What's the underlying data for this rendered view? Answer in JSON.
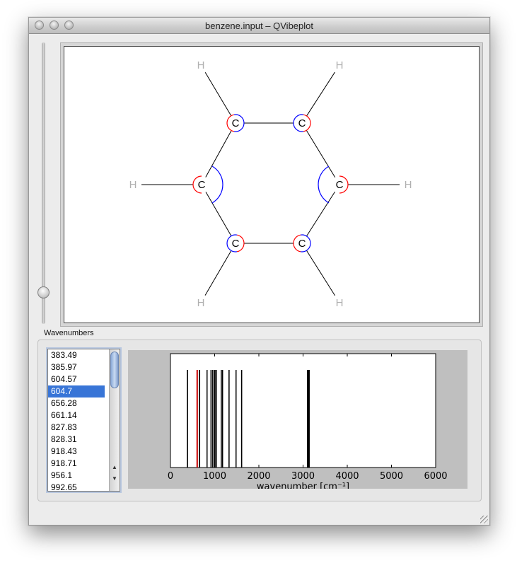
{
  "window": {
    "title": "benzene.input – QVibeplot"
  },
  "molecule": {
    "atoms": [
      {
        "label": "C"
      },
      {
        "label": "C"
      },
      {
        "label": "C"
      },
      {
        "label": "C"
      },
      {
        "label": "C"
      },
      {
        "label": "C"
      },
      {
        "label": "H"
      },
      {
        "label": "H"
      },
      {
        "label": "H"
      },
      {
        "label": "H"
      },
      {
        "label": "H"
      },
      {
        "label": "H"
      }
    ],
    "colors": {
      "carbon_text": "#000000",
      "hydrogen_text": "#b0b0b0",
      "mode_positive": "#0000ff",
      "mode_negative": "#ff0000",
      "bond": "#000000"
    }
  },
  "wavenumbers": {
    "label": "Wavenumbers",
    "items": [
      "383.49",
      "385.97",
      "604.57",
      "604.7",
      "656.28",
      "661.14",
      "827.83",
      "828.31",
      "918.43",
      "918.71",
      "956.1",
      "992.65"
    ],
    "selected": "604.7"
  },
  "chart_data": {
    "type": "bar",
    "title": "",
    "xlabel": "wavenumber [cm⁻¹]",
    "ylabel": "",
    "xlim": [
      0,
      6000
    ],
    "x_ticks": [
      "0",
      "1000",
      "2000",
      "3000",
      "4000",
      "5000",
      "6000"
    ],
    "lines": [
      383.49,
      385.97,
      604.57,
      604.7,
      656.28,
      661.14,
      827.83,
      828.31,
      918.43,
      918.71,
      956.1,
      992.65,
      1010,
      1040,
      1150,
      1178,
      1178,
      1326,
      1326,
      1484,
      1484,
      1610,
      1610,
      3099,
      3110,
      3110,
      3130,
      3130,
      3140
    ],
    "highlighted": 604.7,
    "line_color": "#000000",
    "highlight_color": "#cc0000"
  }
}
